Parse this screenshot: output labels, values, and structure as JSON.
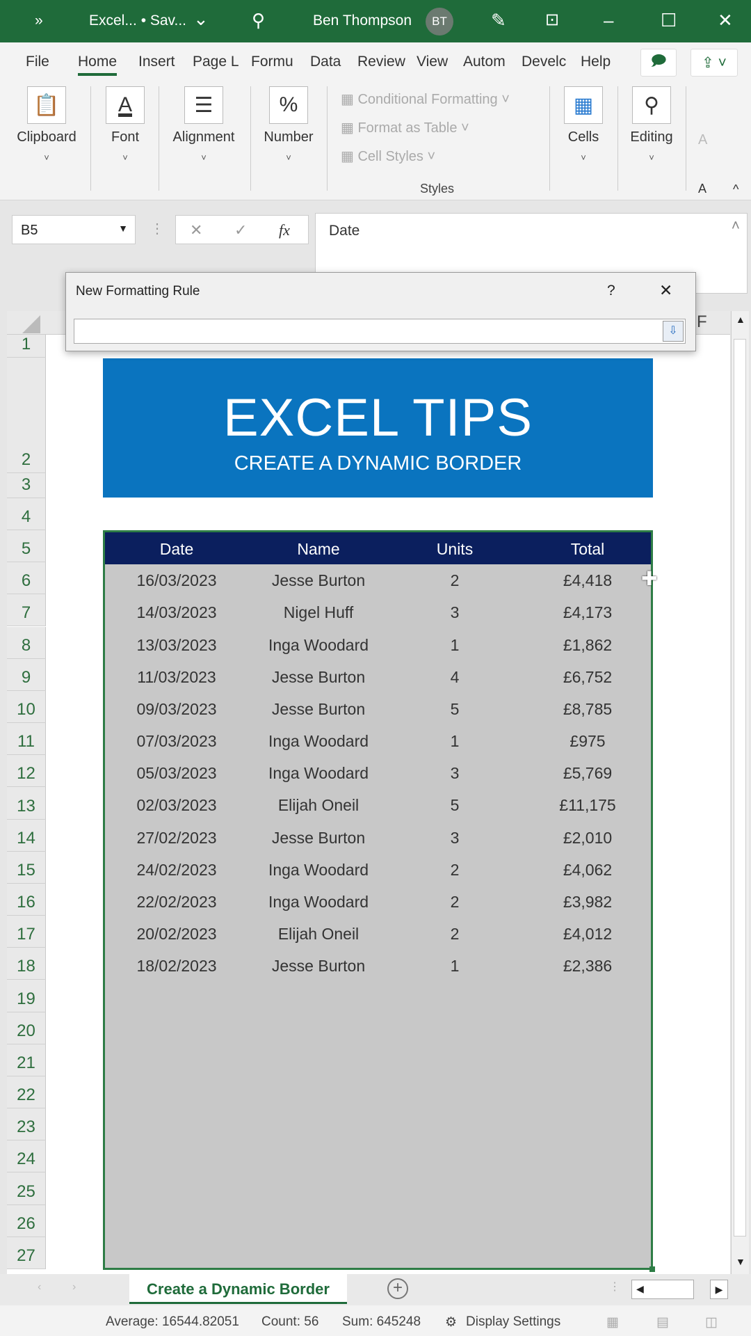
{
  "titlebar": {
    "more": "»",
    "filename": "Excel... • Sav...",
    "dropdown": "⌄",
    "search_icon": "search-icon",
    "user": "Ben Thompson",
    "initials": "BT",
    "accent": "#1f6b3a"
  },
  "tabs": [
    "File",
    "Home",
    "Insert",
    "Page L",
    "Formu",
    "Data",
    "Review",
    "View",
    "Autom",
    "Develc",
    "Help"
  ],
  "ribbon": {
    "groups": [
      "Clipboard",
      "Font",
      "Alignment",
      "Number",
      "Cells",
      "Editing"
    ],
    "styles": {
      "items": [
        "Conditional Formatting ˅",
        "Format as Table ˅",
        "Cell Styles ˅"
      ],
      "label": "Styles"
    },
    "more": "A",
    "more2": "A"
  },
  "formula_bar": {
    "name_box": "B5",
    "cancel": "✕",
    "enter": "✓",
    "fx": "fx",
    "value": "Date"
  },
  "dialog": {
    "title": "New Formatting Rule",
    "help": "?",
    "close": "✕"
  },
  "column_last": "F",
  "banner": {
    "title": "EXCEL TIPS",
    "subtitle": "CREATE A DYNAMIC BORDER",
    "color": "#0a74bf"
  },
  "table": {
    "headers": [
      "Date",
      "Name",
      "Units",
      "Total"
    ],
    "header_color": "#0b1f5e",
    "rows": [
      [
        "16/03/2023",
        "Jesse Burton",
        "2",
        "£4,418"
      ],
      [
        "14/03/2023",
        "Nigel Huff",
        "3",
        "£4,173"
      ],
      [
        "13/03/2023",
        "Inga Woodard",
        "1",
        "£1,862"
      ],
      [
        "11/03/2023",
        "Jesse Burton",
        "4",
        "£6,752"
      ],
      [
        "09/03/2023",
        "Jesse Burton",
        "5",
        "£8,785"
      ],
      [
        "07/03/2023",
        "Inga Woodard",
        "1",
        "£975"
      ],
      [
        "05/03/2023",
        "Inga Woodard",
        "3",
        "£5,769"
      ],
      [
        "02/03/2023",
        "Elijah Oneil",
        "5",
        "£11,175"
      ],
      [
        "27/02/2023",
        "Jesse Burton",
        "3",
        "£2,010"
      ],
      [
        "24/02/2023",
        "Inga Woodard",
        "2",
        "£4,062"
      ],
      [
        "22/02/2023",
        "Inga Woodard",
        "2",
        "£3,982"
      ],
      [
        "20/02/2023",
        "Elijah Oneil",
        "2",
        "£4,012"
      ],
      [
        "18/02/2023",
        "Jesse Burton",
        "1",
        "£2,386"
      ]
    ]
  },
  "row_numbers": [
    "1",
    "2",
    "3",
    "4",
    "5",
    "6",
    "7",
    "8",
    "9",
    "10",
    "11",
    "12",
    "13",
    "14",
    "15",
    "16",
    "17",
    "18",
    "19",
    "20",
    "21",
    "22",
    "23",
    "24",
    "25",
    "26",
    "27"
  ],
  "sheet_tab": "Create a Dynamic Border",
  "status": {
    "average": "Average: 16544.82051",
    "count": "Count: 56",
    "sum": "Sum: 645248",
    "display": "Display Settings"
  }
}
